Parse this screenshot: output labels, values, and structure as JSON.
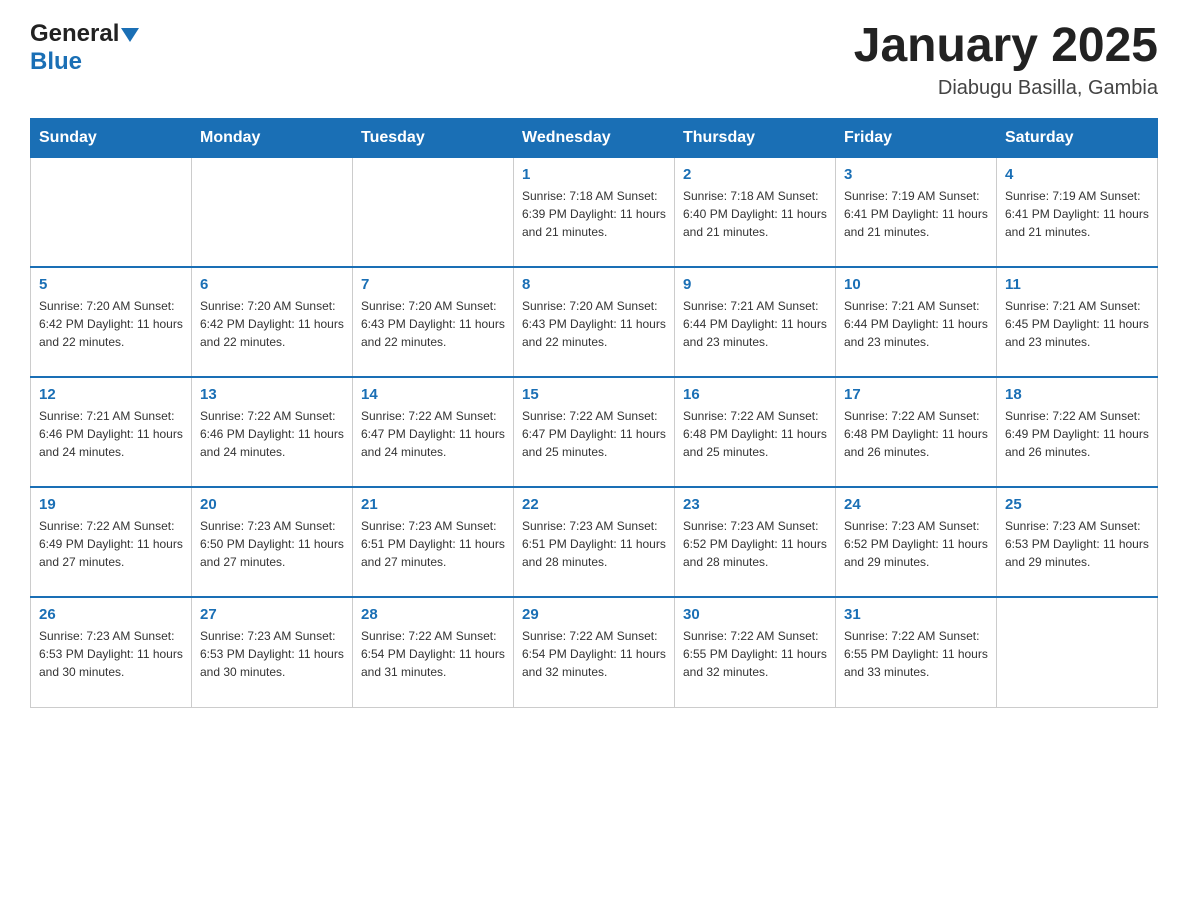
{
  "header": {
    "logo": {
      "general": "General",
      "blue": "Blue"
    },
    "title": "January 2025",
    "subtitle": "Diabugu Basilla, Gambia"
  },
  "days_of_week": [
    "Sunday",
    "Monday",
    "Tuesday",
    "Wednesday",
    "Thursday",
    "Friday",
    "Saturday"
  ],
  "weeks": [
    [
      {
        "day": "",
        "info": ""
      },
      {
        "day": "",
        "info": ""
      },
      {
        "day": "",
        "info": ""
      },
      {
        "day": "1",
        "info": "Sunrise: 7:18 AM\nSunset: 6:39 PM\nDaylight: 11 hours and 21 minutes."
      },
      {
        "day": "2",
        "info": "Sunrise: 7:18 AM\nSunset: 6:40 PM\nDaylight: 11 hours and 21 minutes."
      },
      {
        "day": "3",
        "info": "Sunrise: 7:19 AM\nSunset: 6:41 PM\nDaylight: 11 hours and 21 minutes."
      },
      {
        "day": "4",
        "info": "Sunrise: 7:19 AM\nSunset: 6:41 PM\nDaylight: 11 hours and 21 minutes."
      }
    ],
    [
      {
        "day": "5",
        "info": "Sunrise: 7:20 AM\nSunset: 6:42 PM\nDaylight: 11 hours and 22 minutes."
      },
      {
        "day": "6",
        "info": "Sunrise: 7:20 AM\nSunset: 6:42 PM\nDaylight: 11 hours and 22 minutes."
      },
      {
        "day": "7",
        "info": "Sunrise: 7:20 AM\nSunset: 6:43 PM\nDaylight: 11 hours and 22 minutes."
      },
      {
        "day": "8",
        "info": "Sunrise: 7:20 AM\nSunset: 6:43 PM\nDaylight: 11 hours and 22 minutes."
      },
      {
        "day": "9",
        "info": "Sunrise: 7:21 AM\nSunset: 6:44 PM\nDaylight: 11 hours and 23 minutes."
      },
      {
        "day": "10",
        "info": "Sunrise: 7:21 AM\nSunset: 6:44 PM\nDaylight: 11 hours and 23 minutes."
      },
      {
        "day": "11",
        "info": "Sunrise: 7:21 AM\nSunset: 6:45 PM\nDaylight: 11 hours and 23 minutes."
      }
    ],
    [
      {
        "day": "12",
        "info": "Sunrise: 7:21 AM\nSunset: 6:46 PM\nDaylight: 11 hours and 24 minutes."
      },
      {
        "day": "13",
        "info": "Sunrise: 7:22 AM\nSunset: 6:46 PM\nDaylight: 11 hours and 24 minutes."
      },
      {
        "day": "14",
        "info": "Sunrise: 7:22 AM\nSunset: 6:47 PM\nDaylight: 11 hours and 24 minutes."
      },
      {
        "day": "15",
        "info": "Sunrise: 7:22 AM\nSunset: 6:47 PM\nDaylight: 11 hours and 25 minutes."
      },
      {
        "day": "16",
        "info": "Sunrise: 7:22 AM\nSunset: 6:48 PM\nDaylight: 11 hours and 25 minutes."
      },
      {
        "day": "17",
        "info": "Sunrise: 7:22 AM\nSunset: 6:48 PM\nDaylight: 11 hours and 26 minutes."
      },
      {
        "day": "18",
        "info": "Sunrise: 7:22 AM\nSunset: 6:49 PM\nDaylight: 11 hours and 26 minutes."
      }
    ],
    [
      {
        "day": "19",
        "info": "Sunrise: 7:22 AM\nSunset: 6:49 PM\nDaylight: 11 hours and 27 minutes."
      },
      {
        "day": "20",
        "info": "Sunrise: 7:23 AM\nSunset: 6:50 PM\nDaylight: 11 hours and 27 minutes."
      },
      {
        "day": "21",
        "info": "Sunrise: 7:23 AM\nSunset: 6:51 PM\nDaylight: 11 hours and 27 minutes."
      },
      {
        "day": "22",
        "info": "Sunrise: 7:23 AM\nSunset: 6:51 PM\nDaylight: 11 hours and 28 minutes."
      },
      {
        "day": "23",
        "info": "Sunrise: 7:23 AM\nSunset: 6:52 PM\nDaylight: 11 hours and 28 minutes."
      },
      {
        "day": "24",
        "info": "Sunrise: 7:23 AM\nSunset: 6:52 PM\nDaylight: 11 hours and 29 minutes."
      },
      {
        "day": "25",
        "info": "Sunrise: 7:23 AM\nSunset: 6:53 PM\nDaylight: 11 hours and 29 minutes."
      }
    ],
    [
      {
        "day": "26",
        "info": "Sunrise: 7:23 AM\nSunset: 6:53 PM\nDaylight: 11 hours and 30 minutes."
      },
      {
        "day": "27",
        "info": "Sunrise: 7:23 AM\nSunset: 6:53 PM\nDaylight: 11 hours and 30 minutes."
      },
      {
        "day": "28",
        "info": "Sunrise: 7:22 AM\nSunset: 6:54 PM\nDaylight: 11 hours and 31 minutes."
      },
      {
        "day": "29",
        "info": "Sunrise: 7:22 AM\nSunset: 6:54 PM\nDaylight: 11 hours and 32 minutes."
      },
      {
        "day": "30",
        "info": "Sunrise: 7:22 AM\nSunset: 6:55 PM\nDaylight: 11 hours and 32 minutes."
      },
      {
        "day": "31",
        "info": "Sunrise: 7:22 AM\nSunset: 6:55 PM\nDaylight: 11 hours and 33 minutes."
      },
      {
        "day": "",
        "info": ""
      }
    ]
  ]
}
